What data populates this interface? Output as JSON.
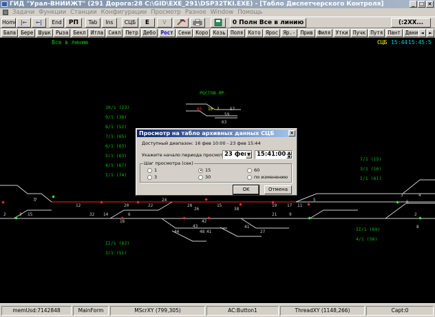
{
  "window": {
    "title": "ГИД \"Урал-ВНИИЖТ\" (291 Дорога:28 C:\\GID\\EXE_291\\DSP32TKI.EXE) - [Табло Диспетчерского Контроля]",
    "buttons": [
      "_",
      "□",
      "×"
    ]
  },
  "menu": [
    "Задачи",
    "Функции",
    "Станции",
    "Конфигурации",
    "Просмотр",
    "Разное",
    "Window",
    "Помощь"
  ],
  "toolbar": {
    "home": "Home",
    "first_icon": "|←",
    "prev_icon": "←|",
    "end": "End",
    "rp": "РП",
    "tab": "Tab",
    "ins": "Ins",
    "sc": "СЦБ",
    "e": "E",
    "v": "V",
    "hammer_icon": "hammer-icon",
    "print_icon": "printer-icon",
    "calc_icon": "calculator-icon",
    "mode_text": "0 Полн Все в линию",
    "zoom_text": "(:2XX..."
  },
  "stations": [
    "Бала",
    "Бере",
    "Шушк",
    "Рыза",
    "Бекл",
    "Итла",
    "Сиял",
    "Петр",
    "Дебо",
    "Рост",
    "Сени",
    "Коро",
    "Козь",
    "Поля",
    "Кото",
    "Ярос",
    "Яр.-",
    "Прив",
    "Филя",
    "Утки",
    "Пучк",
    "Путя",
    "Пант",
    "Дани"
  ],
  "active_station": "Рост",
  "schema": {
    "header_left": "Все в линию",
    "clock_label": "СЦБ",
    "clock_time": "15:44",
    "clock_time2": "15:45:5",
    "station_name": "РОСТОВ-ЯР.",
    "left_tracks": [
      "10/1 (23)",
      "9/1 (36)",
      "8/1 (52)",
      "7/1 (65)",
      "6/1 (63)",
      "5/1 (63)",
      "4/1 (67)",
      "I/1 (74)"
    ],
    "left_bottom": [
      "II/1 (62)",
      "3/1 (51)"
    ],
    "right_tracks": [
      "7/1 (15)",
      "3/1 (16)",
      "I/1 (61)"
    ],
    "right_bottom": [
      "II/1 (69)",
      "4/1 (58)"
    ],
    "platform_nums": [
      "65",
      "10",
      "?",
      "57",
      "59",
      "63"
    ],
    "main_nums": [
      "12",
      "20",
      "24",
      "22",
      "28",
      "15",
      "19",
      "17",
      "11",
      "5",
      "3",
      "6",
      "4",
      "7"
    ],
    "lower_nums": [
      "6",
      "16",
      "14",
      "32",
      "42",
      "26",
      "38",
      "21",
      "9",
      "15",
      "41",
      "27",
      "44",
      "48",
      "43",
      "41",
      "8",
      "2",
      "7",
      "3",
      "2"
    ]
  },
  "dialog": {
    "title": "Просмотр на табло архивных данных СЦБ",
    "range_text": "Доступный диапазон: 16 фев 10:00 - 23 фев 15:44",
    "start_label": "Укажите начало периода просмотра:",
    "date_value": "23 фев",
    "time_value": "15:41:00",
    "group_label": "Шаг просмотра (сек)",
    "options": [
      "1",
      "3",
      "15",
      "30",
      "60",
      "по изменению"
    ],
    "selected_option": "15",
    "ok": "OK",
    "cancel": "Отмена",
    "close": "×"
  },
  "status": [
    "memUsd:7142848",
    "MainForm",
    "MScrXY (799,305)",
    "AC:Button1",
    "ThreadXY (1148,266)",
    "Capt:0"
  ],
  "colors": {
    "track": "#d0d0d0",
    "signal_red": "#ff3030",
    "signal_green": "#40ff40",
    "label_green": "#00c000",
    "label_cyan": "#00d0d0",
    "label_yellow": "#ffff00"
  }
}
